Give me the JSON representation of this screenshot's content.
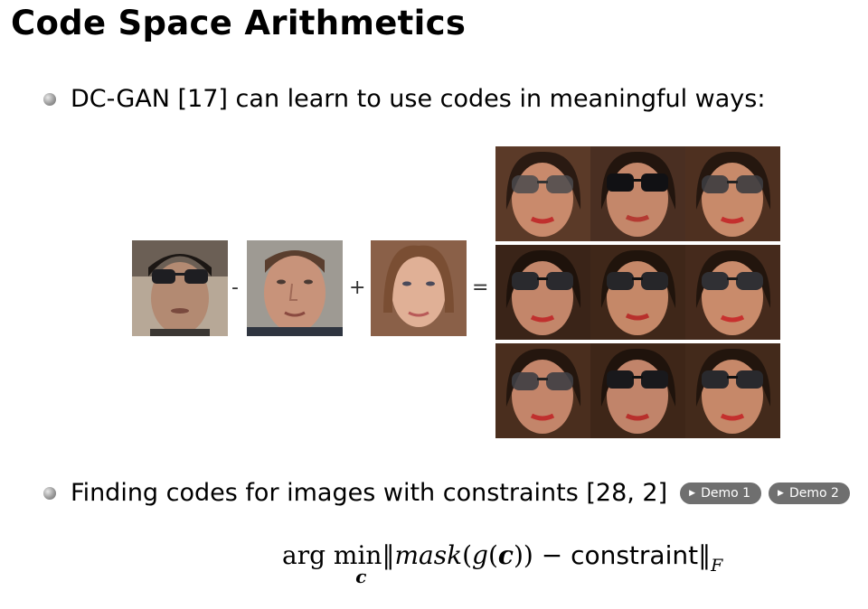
{
  "slide": {
    "title": "Code Space Arithmetics",
    "bullet1": "DC-GAN [17] can learn to use codes in meaningful ways:",
    "bullet2": "Finding codes for images with constraints [28, 2]",
    "demo1_label": "Demo 1",
    "demo2_label": "Demo 2"
  },
  "equation": {
    "minus": "-",
    "plus": "+",
    "equals": "="
  },
  "formula": {
    "arg": "arg",
    "min": "min",
    "sub": "c",
    "norm_open": "‖",
    "mask": "mask",
    "paren_open": "(",
    "g": "g",
    "c": "c",
    "paren_close": "))",
    "minus": " − ",
    "constraint": "constraint",
    "norm_close": "‖",
    "subscript": "F"
  }
}
